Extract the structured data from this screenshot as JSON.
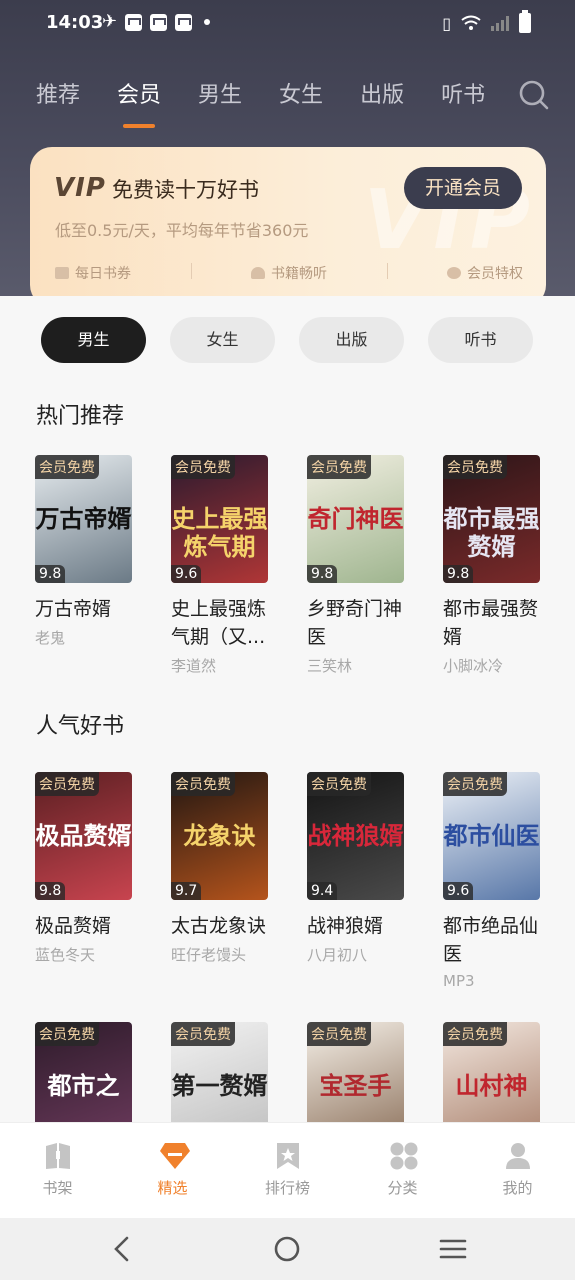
{
  "status_bar": {
    "time": "14:03"
  },
  "top_tabs": [
    "推荐",
    "会员",
    "男生",
    "女生",
    "出版",
    "听书"
  ],
  "active_tab": 1,
  "vip": {
    "logo": "VIP",
    "title": "免费读十万好书",
    "subtitle": "低至0.5元/天，平均每年节省360元",
    "button": "开通会员",
    "bg_text": "VIP",
    "features": [
      "每日书券",
      "书籍畅听",
      "会员特权"
    ]
  },
  "chips": [
    "男生",
    "女生",
    "出版",
    "听书"
  ],
  "active_chip": 0,
  "sections": [
    {
      "title": "热门推荐",
      "books": [
        {
          "badge": "会员免费",
          "score": "9.8",
          "title": "万古帝婿",
          "author": "老鬼",
          "cover_text": "万古帝婿",
          "cover_colors": [
            "#e7ecef",
            "#6b7a86"
          ],
          "text_color": "#111"
        },
        {
          "badge": "会员免费",
          "score": "9.6",
          "title": "史上最强炼气期（又...",
          "author": "李道然",
          "cover_text": "史上最强炼气期",
          "cover_colors": [
            "#2a1a2e",
            "#b03636"
          ],
          "text_color": "#f5d36b"
        },
        {
          "badge": "会员免费",
          "score": "9.8",
          "title": "乡野奇门神医",
          "author": "三笑林",
          "cover_text": "奇门神医",
          "cover_colors": [
            "#f2efe2",
            "#9fb58f"
          ],
          "text_color": "#c0262e"
        },
        {
          "badge": "会员免费",
          "score": "9.8",
          "title": "都市最强赘婿",
          "author": "小脚冰冷",
          "cover_text": "都市最强赘婿",
          "cover_colors": [
            "#2b1518",
            "#7a2a2a"
          ],
          "text_color": "#e6e6f2"
        }
      ]
    },
    {
      "title": "人气好书",
      "books": [
        {
          "badge": "会员免费",
          "score": "9.8",
          "title": "极品赘婿",
          "author": "蓝色冬天",
          "cover_text": "极品赘婿",
          "cover_colors": [
            "#5a1f22",
            "#c8444f"
          ],
          "text_color": "#ffffff"
        },
        {
          "badge": "会员免费",
          "score": "9.7",
          "title": "太古龙象诀",
          "author": "旺仔老馒头",
          "cover_text": "龙象诀",
          "cover_colors": [
            "#201612",
            "#b5541c"
          ],
          "text_color": "#f5d36b"
        },
        {
          "badge": "会员免费",
          "score": "9.4",
          "title": "战神狼婿",
          "author": "八月初八",
          "cover_text": "战神狼婿",
          "cover_colors": [
            "#141414",
            "#4a4a4a"
          ],
          "text_color": "#d8273a"
        },
        {
          "badge": "会员免费",
          "score": "9.6",
          "title": "都市绝品仙医",
          "author": "MP3",
          "cover_text": "都市仙医",
          "cover_colors": [
            "#eef2f7",
            "#5877a8"
          ],
          "text_color": "#2c4ea0"
        }
      ]
    },
    {
      "title": "",
      "books": [
        {
          "badge": "会员免费",
          "score": "",
          "title": "",
          "author": "",
          "cover_text": "都市之",
          "cover_colors": [
            "#2d1b2a",
            "#6e3b5e"
          ],
          "text_color": "#ffffff"
        },
        {
          "badge": "会员免费",
          "score": "",
          "title": "",
          "author": "",
          "cover_text": "第一赘婿",
          "cover_colors": [
            "#f2f2f2",
            "#bdbdbd"
          ],
          "text_color": "#222"
        },
        {
          "badge": "会员免费",
          "score": "",
          "title": "",
          "author": "",
          "cover_text": "宝圣手",
          "cover_colors": [
            "#f5f0e8",
            "#8a6e58"
          ],
          "text_color": "#b1282e"
        },
        {
          "badge": "会员免费",
          "score": "",
          "title": "",
          "author": "",
          "cover_text": "山村神",
          "cover_colors": [
            "#f3e8e0",
            "#a67c67"
          ],
          "text_color": "#c0262e"
        }
      ]
    }
  ],
  "bottom_nav": [
    {
      "label": "书架",
      "icon": "bookshelf-icon"
    },
    {
      "label": "精选",
      "icon": "featured-icon"
    },
    {
      "label": "排行榜",
      "icon": "ranking-icon"
    },
    {
      "label": "分类",
      "icon": "category-icon"
    },
    {
      "label": "我的",
      "icon": "profile-icon"
    }
  ],
  "active_bottom": 1,
  "colors": {
    "accent": "#f0812c",
    "header_bg": "#454657"
  }
}
